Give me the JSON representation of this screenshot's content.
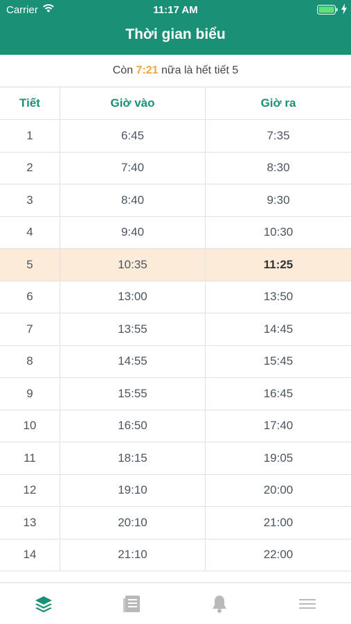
{
  "status_bar": {
    "carrier": "Carrier",
    "time": "11:17 AM"
  },
  "header": {
    "title": "Thời gian biểu",
    "color": "#1a9076"
  },
  "countdown": {
    "prefix": "Còn",
    "remaining": "7:21",
    "suffix": "nữa là hết tiết 5",
    "accent_color": "#f2a43a"
  },
  "table": {
    "columns": [
      "Tiết",
      "Giờ vào",
      "Giờ ra"
    ],
    "current_period": "5",
    "highlight_color": "#fdebd9",
    "rows": [
      {
        "period": "1",
        "start": "6:45",
        "end": "7:35"
      },
      {
        "period": "2",
        "start": "7:40",
        "end": "8:30"
      },
      {
        "period": "3",
        "start": "8:40",
        "end": "9:30"
      },
      {
        "period": "4",
        "start": "9:40",
        "end": "10:30"
      },
      {
        "period": "5",
        "start": "10:35",
        "end": "11:25"
      },
      {
        "period": "6",
        "start": "13:00",
        "end": "13:50"
      },
      {
        "period": "7",
        "start": "13:55",
        "end": "14:45"
      },
      {
        "period": "8",
        "start": "14:55",
        "end": "15:45"
      },
      {
        "period": "9",
        "start": "15:55",
        "end": "16:45"
      },
      {
        "period": "10",
        "start": "16:50",
        "end": "17:40"
      },
      {
        "period": "11",
        "start": "18:15",
        "end": "19:05"
      },
      {
        "period": "12",
        "start": "19:10",
        "end": "20:00"
      },
      {
        "period": "13",
        "start": "20:10",
        "end": "21:00"
      },
      {
        "period": "14",
        "start": "21:10",
        "end": "22:00"
      }
    ]
  },
  "tabbar": {
    "items": [
      {
        "icon": "layers-icon",
        "active": true
      },
      {
        "icon": "notes-icon",
        "active": false
      },
      {
        "icon": "bell-icon",
        "active": false
      },
      {
        "icon": "menu-icon",
        "active": false
      }
    ],
    "active_color": "#1a9076",
    "inactive_color": "#b9b9b9"
  }
}
